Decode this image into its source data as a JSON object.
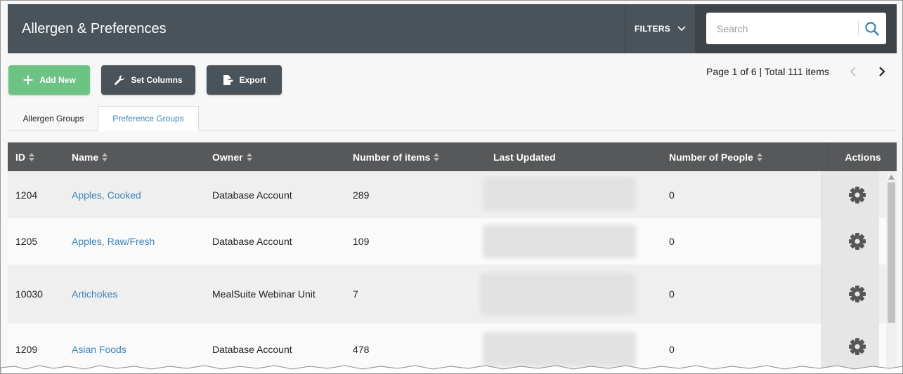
{
  "header": {
    "title": "Allergen & Preferences",
    "filters_label": "FILTERS",
    "search_placeholder": "Search"
  },
  "toolbar": {
    "add_label": "Add New",
    "columns_label": "Set Columns",
    "export_label": "Export"
  },
  "pagination": {
    "text": "Page 1 of 6 | Total 111 items"
  },
  "tabs": [
    {
      "label": "Allergen Groups",
      "active": false
    },
    {
      "label": "Preference Groups",
      "active": true
    }
  ],
  "table": {
    "columns": [
      "ID",
      "Name",
      "Owner",
      "Number of items",
      "Last Updated",
      "Number of People",
      "Actions"
    ],
    "rows": [
      {
        "id": "1204",
        "name": "Apples, Cooked",
        "owner": "Database Account",
        "items": "289",
        "people": "0"
      },
      {
        "id": "1205",
        "name": "Apples, Raw/Fresh",
        "owner": "Database Account",
        "items": "109",
        "people": "0"
      },
      {
        "id": "10030",
        "name": "Artichokes",
        "owner": "MealSuite Webinar Unit",
        "items": "7",
        "people": "0"
      },
      {
        "id": "1209",
        "name": "Asian Foods",
        "owner": "Database Account",
        "items": "478",
        "people": "0"
      }
    ]
  },
  "colors": {
    "header_bg": "#4a5359",
    "accent_green": "#6cc383",
    "link_blue": "#3a83b8",
    "table_head_bg": "#575859"
  },
  "icons": {
    "add": "plus-icon",
    "columns": "wrench-icon",
    "export": "export-file-icon",
    "search": "search-icon",
    "filters": "chevron-down-icon",
    "row_action": "gear-icon"
  }
}
